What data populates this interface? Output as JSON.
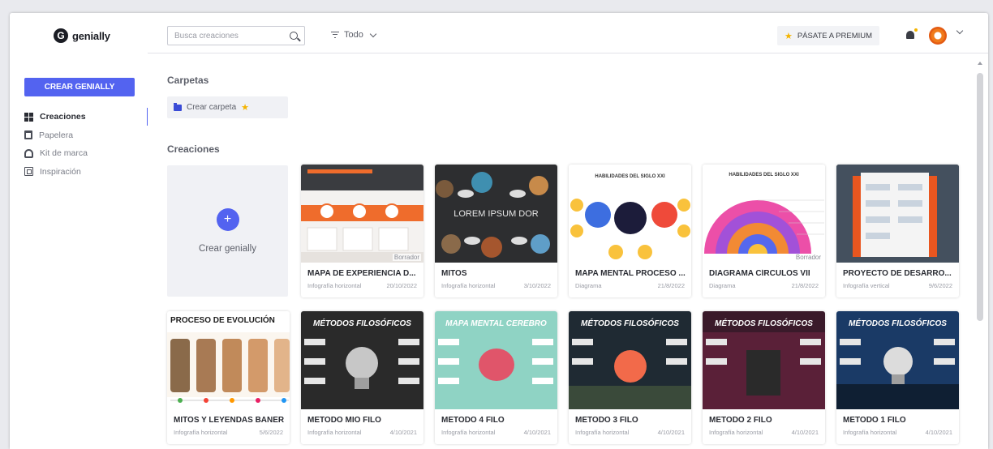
{
  "brand": {
    "logo_letter": "G",
    "name": "genially"
  },
  "sidebar": {
    "create_button": "CREAR GENIALLY",
    "items": [
      {
        "label": "Creaciones",
        "icon": "grid-icon",
        "active": true
      },
      {
        "label": "Papelera",
        "icon": "trash-icon",
        "active": false
      },
      {
        "label": "Kit de marca",
        "icon": "brand-kit-icon",
        "active": false
      },
      {
        "label": "Inspiración",
        "icon": "inspiration-icon",
        "active": false
      }
    ]
  },
  "topbar": {
    "search_placeholder": "Busca creaciones",
    "filter_label": "Todo",
    "premium_label": "PÁSATE A PREMIUM"
  },
  "folders": {
    "title": "Carpetas",
    "create_label": "Crear carpeta"
  },
  "creations": {
    "title": "Creaciones",
    "new_label": "Crear genially",
    "draft_label": "Borrador",
    "cards": [
      {
        "title": "MAPA DE EXPERIENCIA D...",
        "type": "Infografía horizontal",
        "date": "20/10/2022",
        "draft": true
      },
      {
        "title": "MITOS",
        "type": "Infografía horizontal",
        "date": "3/10/2022",
        "draft": false,
        "thumb_text": "LOREM IPSUM DOR"
      },
      {
        "title": "MAPA MENTAL PROCESO ...",
        "type": "Diagrama",
        "date": "21/8/2022",
        "draft": false,
        "thumb_text": "HABILIDADES DEL SIGLO XXI"
      },
      {
        "title": "DIAGRAMA CÍRCULOS VII",
        "type": "Diagrama",
        "date": "21/8/2022",
        "draft": true,
        "thumb_text": "HABILIDADES DEL SIGLO XXI"
      },
      {
        "title": "PROYECTO DE DESARRO...",
        "type": "Infografía vertical",
        "date": "9/6/2022",
        "draft": false
      },
      {
        "title": "MITOS Y LEYENDAS BANER",
        "type": "Infografía horizontal",
        "date": "5/6/2022",
        "draft": false,
        "thumb_text": "PROCESO DE EVOLUCIÓN"
      },
      {
        "title": "METODO MIO FILO",
        "type": "Infografía horizontal",
        "date": "4/10/2021",
        "draft": false,
        "thumb_text": "MÉTODOS FILOSÓFICOS"
      },
      {
        "title": "METODO 4 FILO",
        "type": "Infografía horizontal",
        "date": "4/10/2021",
        "draft": false,
        "thumb_text": "MAPA MENTAL CEREBRO"
      },
      {
        "title": "METODO 3 FILO",
        "type": "Infografía horizontal",
        "date": "4/10/2021",
        "draft": false,
        "thumb_text": "MÉTODOS FILOSÓFICOS"
      },
      {
        "title": "METODO 2 FILO",
        "type": "Infografía horizontal",
        "date": "4/10/2021",
        "draft": false,
        "thumb_text": "MÉTODOS FILOSÓFICOS"
      },
      {
        "title": "METODO 1 FILO",
        "type": "Infografía horizontal",
        "date": "4/10/2021",
        "draft": false,
        "thumb_text": "MÉTODOS FILOSÓFICOS"
      }
    ]
  },
  "colors": {
    "accent": "#5363f0",
    "premium_star": "#f4b400",
    "avatar": "#e35a12"
  }
}
